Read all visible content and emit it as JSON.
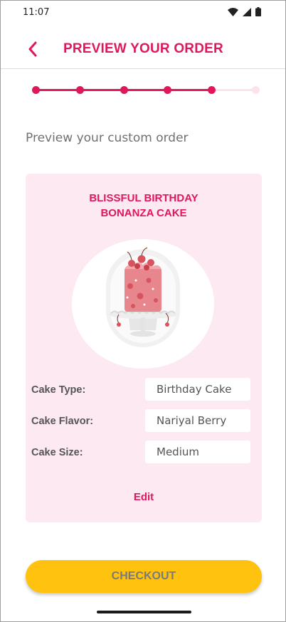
{
  "status_bar": {
    "time": "11:07",
    "icons": [
      "wifi-icon",
      "cell-signal-icon",
      "battery-icon"
    ]
  },
  "header": {
    "title": "PREVIEW YOUR ORDER",
    "back_icon": "chevron-left-icon"
  },
  "stepper": {
    "total_steps": 6,
    "completed_steps": 5,
    "active_color": "#e0175d",
    "inactive_color": "#fbe3ec"
  },
  "subtitle": "Preview your custom order",
  "order": {
    "cake_name_line1": "BLISSFUL BIRTHDAY",
    "cake_name_line2": "BONANZA CAKE",
    "details": [
      {
        "label": "Cake Type:",
        "value": "Birthday Cake"
      },
      {
        "label": "Cake Flavor:",
        "value": "Nariyal Berry"
      },
      {
        "label": "Cake Size:",
        "value": "Medium"
      }
    ],
    "edit_label": "Edit"
  },
  "checkout_label": "CHECKOUT",
  "colors": {
    "brand": "#e0175d",
    "card_background": "#fde9f1",
    "checkout_button": "#ffc20e"
  }
}
